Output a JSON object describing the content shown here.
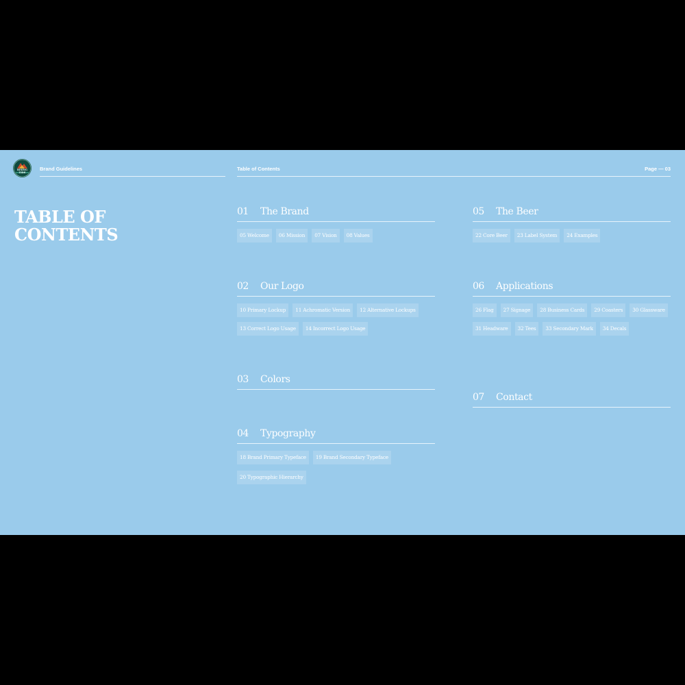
{
  "header": {
    "brand_label": "Brand Guidelines",
    "section_label": "Table of Contents",
    "page_label": "Page — 03",
    "logo_text_line1": "RISING",
    "logo_text_line2": "TIDE"
  },
  "title": {
    "line1": "TABLE OF",
    "line2": "CONTENTS"
  },
  "sections": [
    {
      "num": "01",
      "title": "The Brand",
      "items": [
        "05 Welcome",
        "06 Mission",
        "07 Vision",
        "08 Values"
      ]
    },
    {
      "num": "02",
      "title": "Our Logo",
      "items": [
        "10 Primary Lockup",
        "11 Achromatic Version",
        "12 Alternative Lockups",
        "13 Correct Logo Usage",
        "14 Incorrect Logo Usage"
      ]
    },
    {
      "num": "03",
      "title": "Colors",
      "items": []
    },
    {
      "num": "04",
      "title": "Typography",
      "items": [
        "18 Brand Primary Typeface",
        "19 Brand Secondary Typeface",
        "20 Typographic Hierarchy"
      ]
    },
    {
      "num": "05",
      "title": "The Beer",
      "items": [
        "22 Core Beer",
        "23 Label System",
        "24 Examples"
      ]
    },
    {
      "num": "06",
      "title": "Applications",
      "items": [
        "26 Flag",
        "27 Signage",
        "28 Business Cards",
        "29 Coasters",
        "30 Glassware",
        "31 Headware",
        "32 Tees",
        "33 Secondary Mark",
        "34 Decals"
      ]
    },
    {
      "num": "07",
      "title": "Contact",
      "items": []
    }
  ],
  "colors": {
    "background": "#9acbeb",
    "logo": "#0f4a3e",
    "text": "#ffffff"
  }
}
